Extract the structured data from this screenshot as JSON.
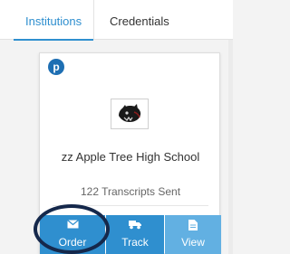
{
  "tabs": [
    {
      "label": "Institutions",
      "active": true
    },
    {
      "label": "Credentials",
      "active": false
    }
  ],
  "card": {
    "badge_letter": "p",
    "logo_icon": "panther-logo-icon",
    "school_name": "zz Apple Tree High School",
    "transcripts_sent": "122 Transcripts Sent",
    "actions": {
      "order": {
        "label": "Order",
        "icon": "envelope-icon"
      },
      "track": {
        "label": "Track",
        "icon": "truck-icon"
      },
      "view": {
        "label": "View",
        "icon": "document-icon"
      }
    }
  },
  "colors": {
    "accent": "#2f8fcf",
    "accent_light": "#62b0e2",
    "badge": "#1e6fb3",
    "highlight_ring": "#15284b"
  }
}
